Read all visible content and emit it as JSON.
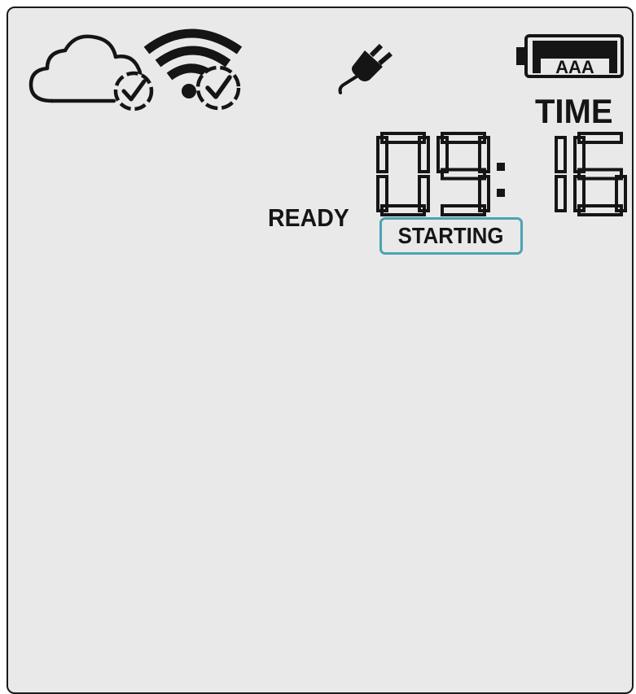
{
  "display": {
    "icons": {
      "cloud": "cloud-connected-icon",
      "wifi": "wifi-connected-icon",
      "power": "power-plug-icon",
      "battery": "battery-icon"
    },
    "battery_type": "AAA",
    "battery_level": 1.0,
    "time_label": "TIME",
    "clock": {
      "hours": "09",
      "minutes": "16",
      "display": "09:16"
    },
    "ready_label": "READY",
    "status": "STARTING"
  },
  "colors": {
    "background": "#e9e9e9",
    "segment": "#151515",
    "status_outline": "#4aa3b3"
  }
}
